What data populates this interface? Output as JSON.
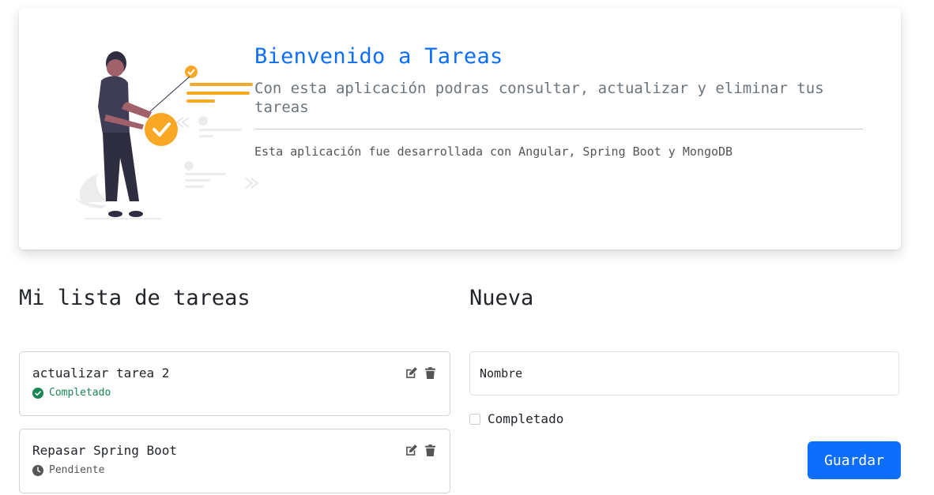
{
  "hero": {
    "title": "Bienvenido a Tareas",
    "lead": "Con esta aplicación podras consultar, actualizar y eliminar tus tareas",
    "footnote": "Esta aplicación fue desarrollada con Angular, Spring Boot y MongoDB",
    "illustration": "person-checklist-illustration"
  },
  "list": {
    "title": "Mi lista de tareas",
    "tasks": [
      {
        "name": "actualizar tarea 2",
        "status": "Completado",
        "status_icon": "check-circle-icon"
      },
      {
        "name": "Repasar Spring Boot",
        "status": "Pendiente",
        "status_icon": "clock-icon"
      }
    ]
  },
  "form": {
    "title": "Nueva",
    "name_placeholder": "Nombre",
    "completed_label": "Completado",
    "completed_checked": false,
    "save_label": "Guardar"
  },
  "colors": {
    "primary": "#0d6efd",
    "success": "#198754",
    "accent": "#f9a826"
  }
}
